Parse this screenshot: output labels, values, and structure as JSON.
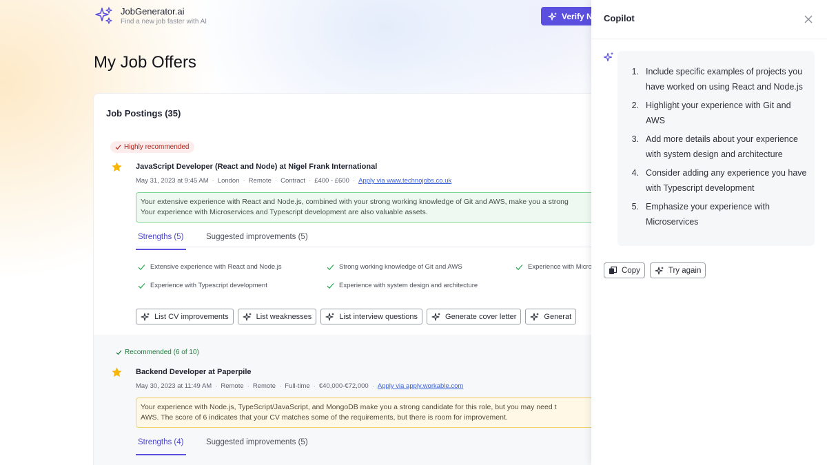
{
  "header": {
    "brand_name": "JobGenerator.ai",
    "brand_tagline": "Find a new job faster with AI",
    "verify_label": "Verify N"
  },
  "page": {
    "title": "My Job Offers"
  },
  "postings_card": {
    "title": "Job Postings (35)"
  },
  "postings": [
    {
      "badge": "Highly recommended",
      "title": "JavaScript Developer (React and Node) at Nigel Frank International",
      "date": "May 31, 2023 at 9:45 AM",
      "location": "London",
      "work_mode": "Remote",
      "contract": "Contract",
      "salary": "£400 - £600",
      "apply": "Apply via www.technojobs.co.uk",
      "summary_line1": "Your extensive experience with React and Node.js, combined with your strong working knowledge of Git and AWS, make you a strong",
      "summary_line2": "Your experience with Microservices and Typescript development are also valuable assets.",
      "tab_strengths": "Strengths (5)",
      "tab_improvements": "Suggested improvements (5)",
      "strengths": [
        "Extensive experience with React and Node.js",
        "Strong working knowledge of Git and AWS",
        "Experience with Micro",
        "Experience with Typescript development",
        "Experience with system design and architecture"
      ],
      "actions": [
        "List CV improvements",
        "List weaknesses",
        "List interview questions",
        "Generate cover letter",
        "Generat"
      ]
    },
    {
      "badge": "Recommended (6 of 10)",
      "title": "Backend Developer at Paperpile",
      "date": "May 30, 2023 at 11:49 AM",
      "location": "Remote",
      "work_mode": "Remote",
      "contract": "Full-time",
      "salary": "€40,000-€72,000",
      "apply": "Apply via apply.workable.com",
      "summary_line1": "Your experience with Node.js, TypeScript/JavaScript, and MongoDB make you a strong candidate for this role, but you may need t",
      "summary_line2": "AWS. The score of 6 indicates that your CV matches some of the requirements, but there is room for improvement.",
      "tab_strengths": "Strengths (4)",
      "tab_improvements": "Suggested improvements (5)"
    }
  ],
  "copilot": {
    "title": "Copilot",
    "suggestions": [
      {
        "num": "1.",
        "text": "Include specific examples of projects you have worked on using React and Node.js"
      },
      {
        "num": "2.",
        "text": "Highlight your experience with Git and AWS"
      },
      {
        "num": "3.",
        "text": "Add more details about your experience with system design and architecture"
      },
      {
        "num": "4.",
        "text": "Consider adding any experience you have with Typescript development"
      },
      {
        "num": "5.",
        "text": "Emphasize your experience with Microservices"
      }
    ],
    "copy_label": "Copy",
    "retry_label": "Try again"
  },
  "colors": {
    "accent": "#5b4fe0",
    "recommended_red": "#b42318",
    "recommended_green": "#1d7a3a",
    "star": "#f5b50a"
  },
  "icons": [
    "sparkles-icon",
    "star-icon",
    "check-icon",
    "close-icon",
    "copy-icon"
  ]
}
